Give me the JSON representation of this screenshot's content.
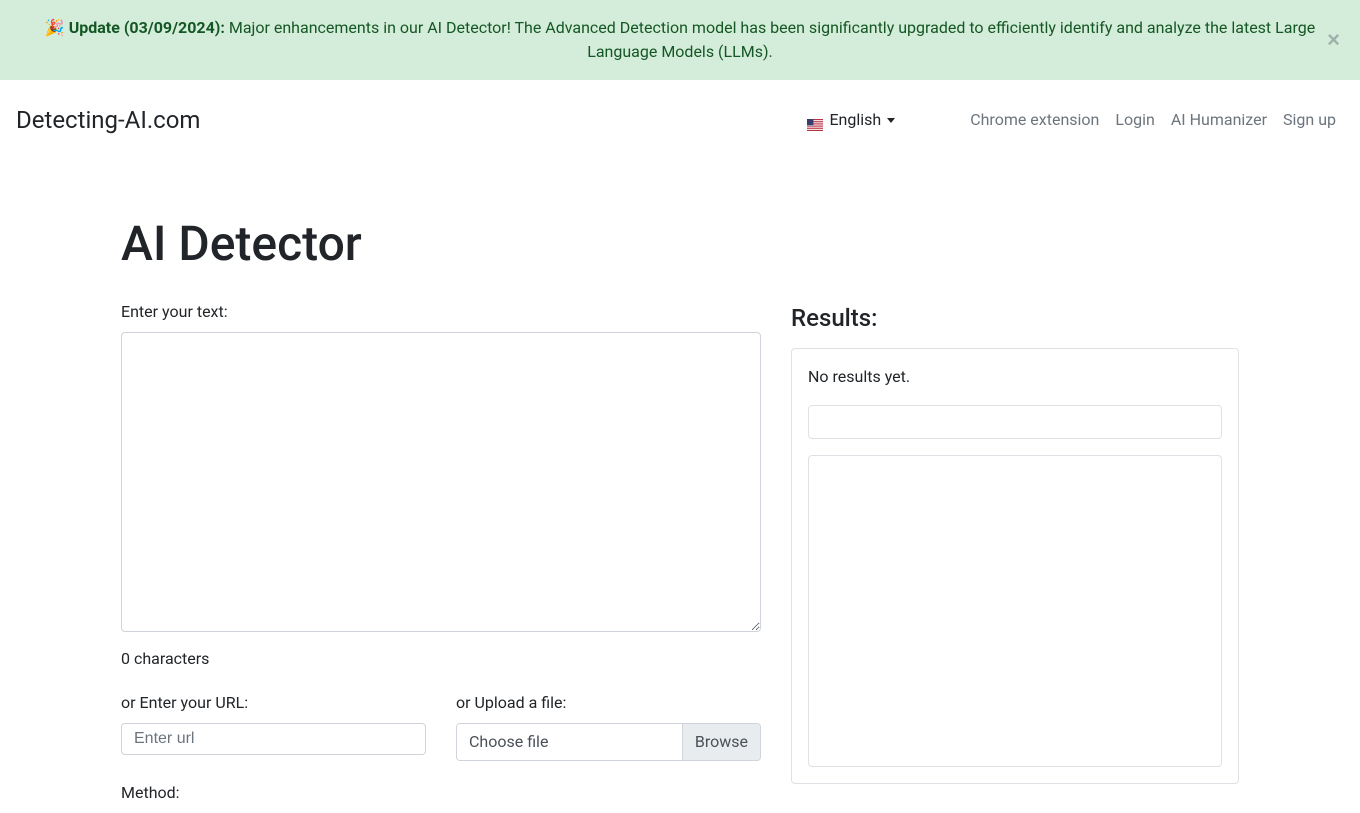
{
  "alert": {
    "emoji": "🎉",
    "bold_text": "Update (03/09/2024):",
    "body_text": " Major enhancements in our AI Detector! The Advanced Detection model has been significantly upgraded to efficiently identify and analyze the latest Large Language Models (LLMs)."
  },
  "navbar": {
    "brand": "Detecting-AI.com",
    "language": "English",
    "links": {
      "chrome_extension": "Chrome extension",
      "login": "Login",
      "ai_humanizer": "AI Humanizer",
      "sign_up": "Sign up"
    }
  },
  "main": {
    "heading": "AI Detector",
    "enter_text_label": "Enter your text:",
    "char_count": "0 characters",
    "url_label": "or Enter your URL:",
    "url_placeholder": "Enter url",
    "upload_label": "or Upload a file:",
    "file_placeholder": "Choose file",
    "browse_label": "Browse",
    "method_label": "Method:"
  },
  "results": {
    "heading": "Results:",
    "no_results_text": "No results yet."
  }
}
